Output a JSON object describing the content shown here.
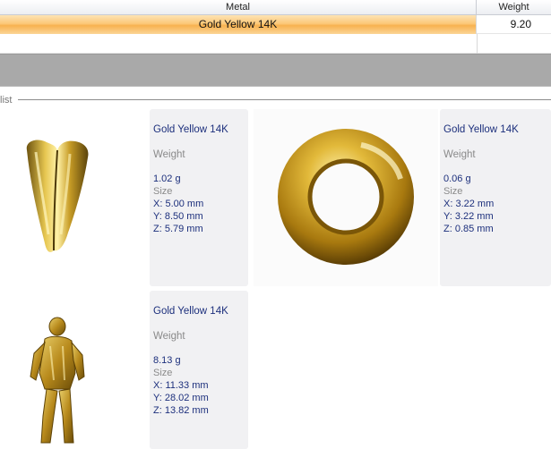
{
  "grid": {
    "columns": [
      "Metal",
      "Weight"
    ],
    "rows": [
      {
        "metal": "Gold Yellow 14K",
        "weight": "9.20"
      }
    ]
  },
  "groupbox": {
    "caption": "list"
  },
  "labels": {
    "weight": "Weight",
    "size": "Size"
  },
  "items": [
    {
      "icon": "pendant-bail-icon",
      "metal": "Gold Yellow 14K",
      "weight": "1.02 g",
      "x": "X: 5.00 mm",
      "y": "Y: 8.50 mm",
      "z": "Z: 5.79 mm"
    },
    {
      "icon": "ring-icon",
      "metal": "Gold Yellow 14K",
      "weight": "0.06 g",
      "x": "X: 3.22 mm",
      "y": "Y: 3.22 mm",
      "z": "Z: 0.85 mm"
    },
    {
      "icon": "figure-icon",
      "metal": "Gold Yellow 14K",
      "weight": "8.13 g",
      "x": "X: 11.33 mm",
      "y": "Y: 28.02 mm",
      "z": "Z: 13.82 mm"
    }
  ],
  "colors": {
    "selected_row": "#fcc878",
    "value_text": "#1c2f7c",
    "label_text": "#8a8a8a",
    "gold": "#c9a227"
  }
}
